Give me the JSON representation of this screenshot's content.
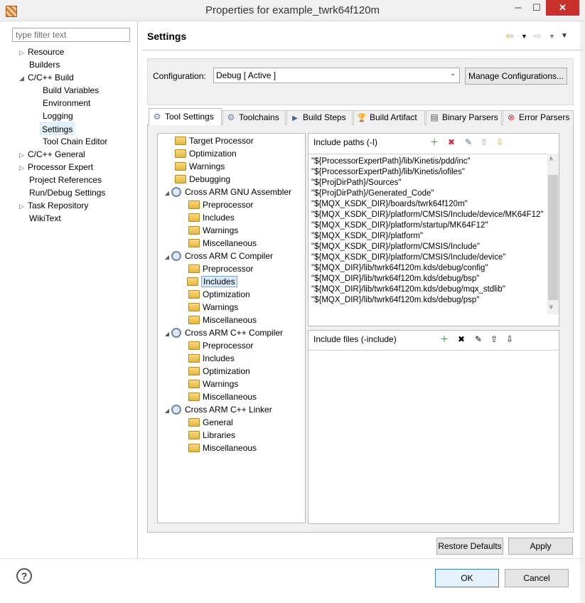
{
  "window": {
    "title": "Properties for example_twrk64f120m",
    "minimize": "─",
    "maximize": "☐",
    "close": "✕"
  },
  "filter": {
    "placeholder": "type filter text"
  },
  "nav": {
    "items": [
      {
        "label": "Resource",
        "twisty": "▷"
      },
      {
        "label": "Builders",
        "twisty": ""
      },
      {
        "label": "C/C++ Build",
        "twisty": "◢"
      },
      {
        "label": "Build Variables",
        "twisty": ""
      },
      {
        "label": "Environment",
        "twisty": ""
      },
      {
        "label": "Logging",
        "twisty": ""
      },
      {
        "label": "Settings",
        "twisty": ""
      },
      {
        "label": "Tool Chain Editor",
        "twisty": ""
      },
      {
        "label": "C/C++ General",
        "twisty": "▷"
      },
      {
        "label": "Processor Expert",
        "twisty": "▷"
      },
      {
        "label": "Project References",
        "twisty": ""
      },
      {
        "label": "Run/Debug Settings",
        "twisty": ""
      },
      {
        "label": "Task Repository",
        "twisty": "▷"
      },
      {
        "label": "WikiText",
        "twisty": ""
      }
    ]
  },
  "header": {
    "title": "Settings",
    "back_icon": "⇦",
    "forward_icon": "⇨",
    "menu_arrow": "▼"
  },
  "config": {
    "label": "Configuration:",
    "value": "Debug  [ Active ]",
    "dropdown_arrow": "⌄",
    "manage_label": "Manage Configurations..."
  },
  "tabs": [
    {
      "label": "Tool Settings",
      "icon": "⚙"
    },
    {
      "label": "Toolchains",
      "icon": "⚙"
    },
    {
      "label": "Build Steps",
      "icon": "▶"
    },
    {
      "label": "Build Artifact",
      "icon": "🏆"
    },
    {
      "label": "Binary Parsers",
      "icon": "▤"
    },
    {
      "label": "Error Parsers",
      "icon": "⊗"
    }
  ],
  "tool_tree": {
    "items": [
      {
        "label": "Target Processor"
      },
      {
        "label": "Optimization"
      },
      {
        "label": "Warnings"
      },
      {
        "label": "Debugging"
      },
      {
        "label": "Cross ARM GNU Assembler"
      },
      {
        "label": "Preprocessor"
      },
      {
        "label": "Includes"
      },
      {
        "label": "Warnings"
      },
      {
        "label": "Miscellaneous"
      },
      {
        "label": "Cross ARM C Compiler"
      },
      {
        "label": "Preprocessor"
      },
      {
        "label": "Includes"
      },
      {
        "label": "Optimization"
      },
      {
        "label": "Warnings"
      },
      {
        "label": "Miscellaneous"
      },
      {
        "label": "Cross ARM C++ Compiler"
      },
      {
        "label": "Preprocessor"
      },
      {
        "label": "Includes"
      },
      {
        "label": "Optimization"
      },
      {
        "label": "Warnings"
      },
      {
        "label": "Miscellaneous"
      },
      {
        "label": "Cross ARM C++ Linker"
      },
      {
        "label": "General"
      },
      {
        "label": "Libraries"
      },
      {
        "label": "Miscellaneous"
      }
    ],
    "twisty": "◢"
  },
  "include_paths": {
    "title": "Include paths (-I)",
    "paths": [
      "\"${ProcessorExpertPath}/lib/Kinetis/pdd/inc\"",
      "\"${ProcessorExpertPath}/lib/Kinetis/iofiles\"",
      "\"${ProjDirPath}/Sources\"",
      "\"${ProjDirPath}/Generated_Code\"",
      "\"${MQX_KSDK_DIR}/boards/twrk64f120m\"",
      "\"${MQX_KSDK_DIR}/platform/CMSIS/Include/device/MK64F12\"",
      "\"${MQX_KSDK_DIR}/platform/startup/MK64F12\"",
      "\"${MQX_KSDK_DIR}/platform\"",
      "\"${MQX_KSDK_DIR}/platform/CMSIS/Include\"",
      "\"${MQX_KSDK_DIR}/platform/CMSIS/Include/device\"",
      "\"${MQX_DIR}/lib/twrk64f120m.kds/debug/config\"",
      "\"${MQX_DIR}/lib/twrk64f120m.kds/debug/bsp\"",
      "\"${MQX_DIR}/lib/twrk64f120m.kds/debug/mqx_stdlib\"",
      "\"${MQX_DIR}/lib/twrk64f120m.kds/debug/psp\""
    ],
    "scroll_up": "∧",
    "scroll_down": "∨"
  },
  "include_files": {
    "title": "Include files (-include)"
  },
  "toolbar_icons": {
    "add": "＋",
    "delete": "✖",
    "edit": "✎",
    "move_up": "⇧",
    "move_down": "⇩"
  },
  "buttons": {
    "restore_defaults": "Restore Defaults",
    "apply": "Apply",
    "ok": "OK",
    "cancel": "Cancel",
    "help": "?"
  }
}
